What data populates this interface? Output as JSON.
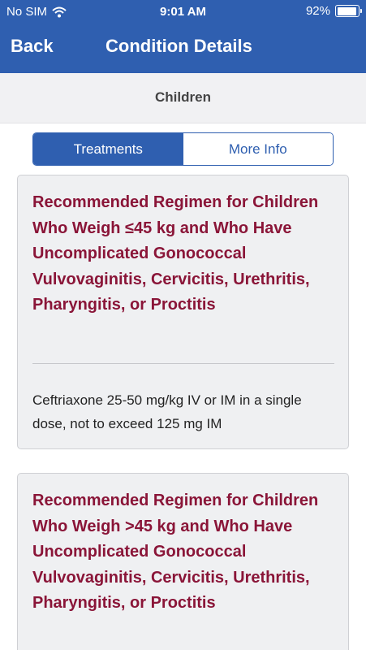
{
  "status_bar": {
    "carrier": "No SIM",
    "time": "9:01 AM",
    "battery": "92%",
    "battery_level": 0.92
  },
  "nav": {
    "back_label": "Back",
    "title": "Condition Details"
  },
  "section": {
    "title": "Children"
  },
  "tabs": [
    {
      "label": "Treatments",
      "active": true
    },
    {
      "label": "More Info",
      "active": false
    }
  ],
  "cards": [
    {
      "title": "Recommended Regimen for Children Who Weigh ≤45 kg and Who Have Uncomplicated Gonococcal Vulvovaginitis, Cervicitis, Urethritis, Pharyngitis, or Proctitis",
      "body": "Ceftriaxone 25-50 mg/kg IV or IM in a single dose, not to exceed 125 mg IM"
    },
    {
      "title": "Recommended Regimen for Children Who Weigh >45 kg and Who Have Uncomplicated Gonococcal Vulvovaginitis, Cervicitis, Urethritis, Pharyngitis, or Proctitis"
    }
  ],
  "colors": {
    "brand_blue": "#2f5fb0",
    "title_red": "#8a1538"
  }
}
